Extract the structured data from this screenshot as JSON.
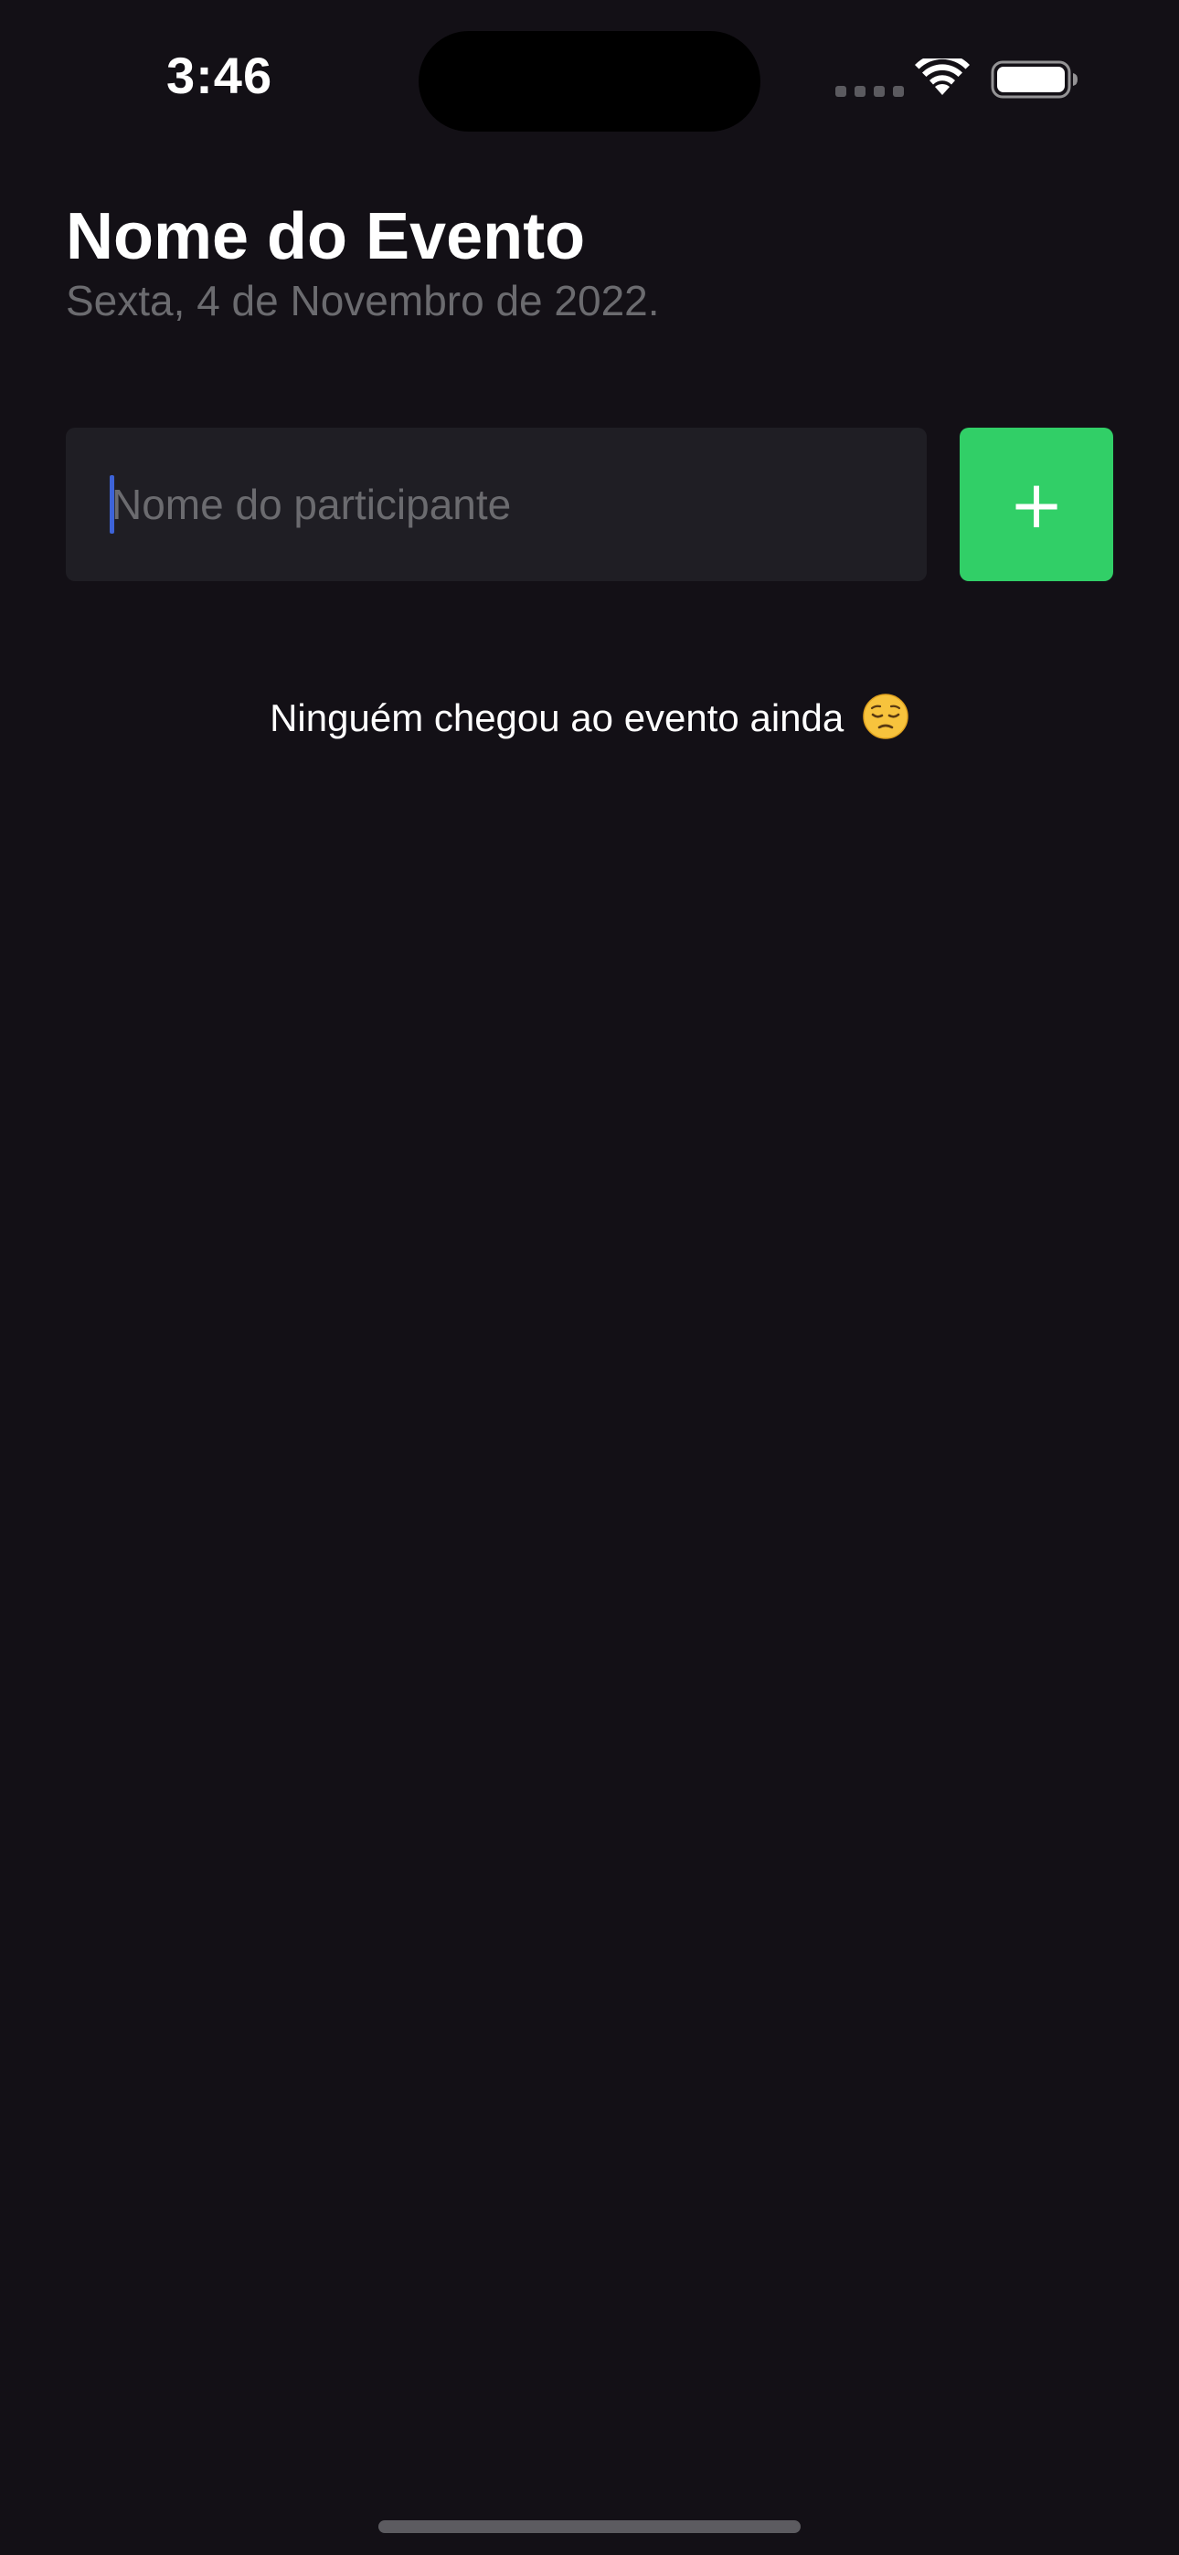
{
  "status_bar": {
    "time": "3:46",
    "icons": [
      "signal-dots-icon",
      "wifi-icon",
      "battery-icon"
    ]
  },
  "header": {
    "title": "Nome do Evento",
    "date": "Sexta, 4 de Novembro de 2022."
  },
  "form": {
    "participant_input": {
      "placeholder": "Nome do participante",
      "value": ""
    },
    "add_button_label": "+"
  },
  "empty_state": {
    "message": "Ninguém chegou ao evento ainda",
    "emoji_icon": "pensive-face-icon"
  },
  "colors": {
    "background": "#131016",
    "input_background": "#1F1E24",
    "accent_green": "#31CF67",
    "muted_text": "#6B6B6F",
    "cursor": "#3D63D8"
  }
}
